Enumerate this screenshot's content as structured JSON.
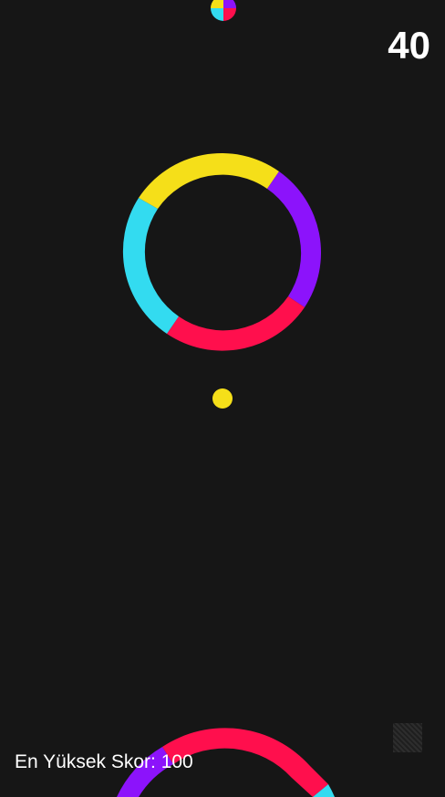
{
  "hud": {
    "score": "40",
    "best_score_label": "En Yüksek Skor: 100"
  },
  "colors": {
    "background": "#161616",
    "yellow": "#f5df19",
    "purple": "#8c13fb",
    "red": "#ff0f4d",
    "cyan": "#33dbf0"
  },
  "icons": {
    "color_switcher": "color-switcher-icon",
    "player_ball": "player-ball-icon",
    "ring_obstacle": "ring-obstacle-icon"
  },
  "player": {
    "color": "yellow"
  }
}
